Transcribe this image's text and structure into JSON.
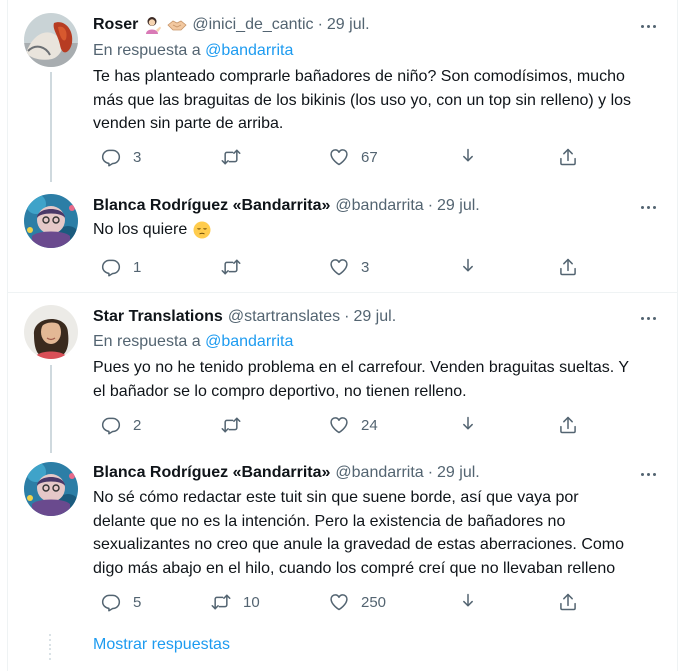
{
  "tweets": [
    {
      "display_name": "Roser",
      "emojis": [
        "woman-tipping-hand",
        "handshake"
      ],
      "handle": "@inici_de_cantic",
      "dot": "·",
      "date": "29 jul.",
      "reply_prefix": "En respuesta a",
      "reply_to": "@bandarrita",
      "lines": [
        "Te has planteado comprarle bañadores de niño? Son comodísimos, mucho",
        "más que las braguitas de los bikinis (los uso yo, con un top sin relleno) y los",
        "venden sin parte de arriba."
      ],
      "replies": "3",
      "retweets": "",
      "likes": "67"
    },
    {
      "display_name": "Blanca Rodríguez «Bandarrita»",
      "handle": "@bandarrita",
      "dot": "·",
      "date": "29 jul.",
      "lines": [
        "No los quiere"
      ],
      "emoji": "pensive-face",
      "replies": "1",
      "retweets": "",
      "likes": "3"
    },
    {
      "display_name": "Star Translations",
      "handle": "@startranslates",
      "dot": "·",
      "date": "29 jul.",
      "reply_prefix": "En respuesta a",
      "reply_to": "@bandarrita",
      "lines": [
        "Pues yo no he tenido problema en el carrefour. Venden braguitas sueltas. Y",
        "el bañador se lo compro deportivo, no tienen relleno."
      ],
      "replies": "2",
      "retweets": "",
      "likes": "24"
    },
    {
      "display_name": "Blanca Rodríguez «Bandarrita»",
      "handle": "@bandarrita",
      "dot": "·",
      "date": "29 jul.",
      "lines": [
        "No sé cómo redactar este tuit sin que suene borde, así que vaya por",
        "delante que no es la intención. Pero la existencia de bañadores no",
        "sexualizantes no creo que anule la gravedad de estas aberraciones. Como",
        "digo más abajo en el hilo, cuando los compré creí que no llevaban relleno"
      ],
      "replies": "5",
      "retweets": "10",
      "likes": "250"
    }
  ],
  "show_replies": "Mostrar respuestas",
  "icons": [
    "reply-icon",
    "retweet-icon",
    "like-icon",
    "share-icon",
    "share-upload-icon",
    "more-icon"
  ],
  "colors": {
    "accent": "#1d9bf0",
    "secondary": "#536471",
    "text": "#0f1419",
    "line": "#cfd9de"
  }
}
